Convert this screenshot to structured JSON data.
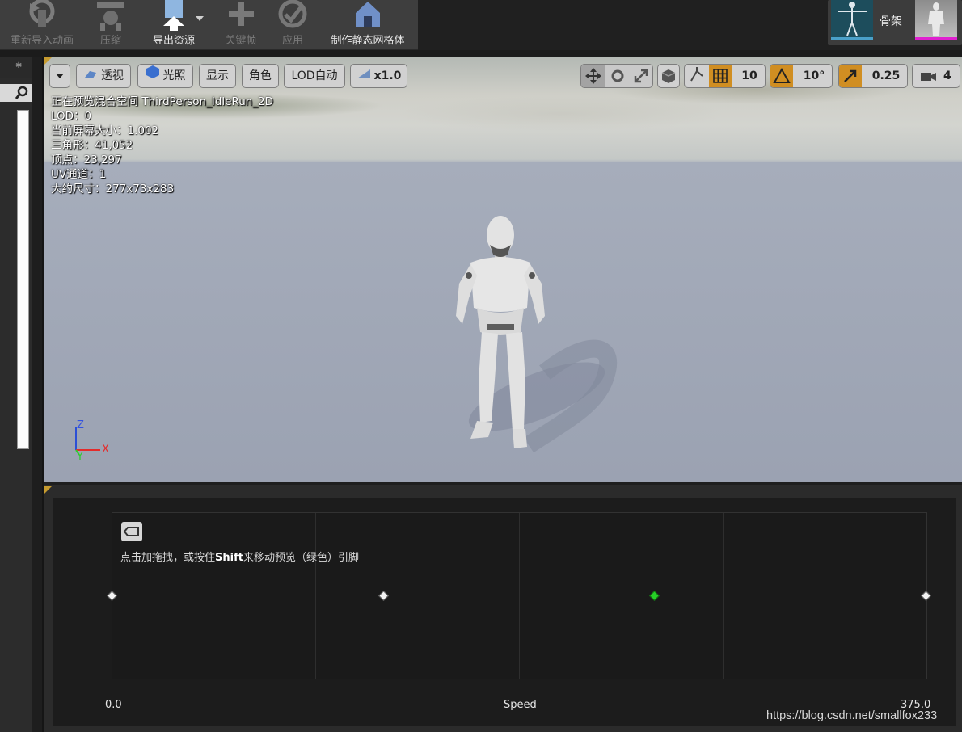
{
  "toolbar": {
    "reimport_label": "重新导入动画",
    "compress_label": "压缩",
    "export_label": "导出资源",
    "keyframe_label": "关键帧",
    "apply_label": "应用",
    "make_static_mesh_label": "制作静态网格体"
  },
  "asset_tabs": {
    "skeleton_label": "骨架"
  },
  "viewport": {
    "perspective_label": "透视",
    "lit_label": "光照",
    "show_label": "显示",
    "character_label": "角色",
    "lod_label": "LOD自动",
    "speed_label": "x1.0",
    "grid_snap_value": "10",
    "rotation_snap_value": "10°",
    "scale_snap_value": "0.25",
    "camera_speed_value": "4",
    "stats": [
      "正在预览混合空间 ThirdPerson_IdleRun_2D",
      "LOD：0",
      "当前屏幕大小：1.002",
      "三角形：41,052",
      "顶点：23,297",
      "UV通道：1",
      "大约尺寸：277x73x283"
    ],
    "axis_z": "Z",
    "axis_x": "X",
    "axis_y": "Y"
  },
  "blendspace": {
    "hint_prefix": "点击加拖拽，或按住",
    "hint_key": "Shift",
    "hint_suffix": "来移动预览（绿色）引脚",
    "axis_min": "0.0",
    "axis_name": "Speed",
    "axis_max": "375.0",
    "samples": [
      0.0,
      125.0,
      250.0,
      375.0
    ],
    "preview_value": 250.0
  },
  "watermark": "https://blog.csdn.net/smallfox233",
  "colors": {
    "accent_orange": "#c69b2f",
    "preview_green": "#27d027"
  }
}
